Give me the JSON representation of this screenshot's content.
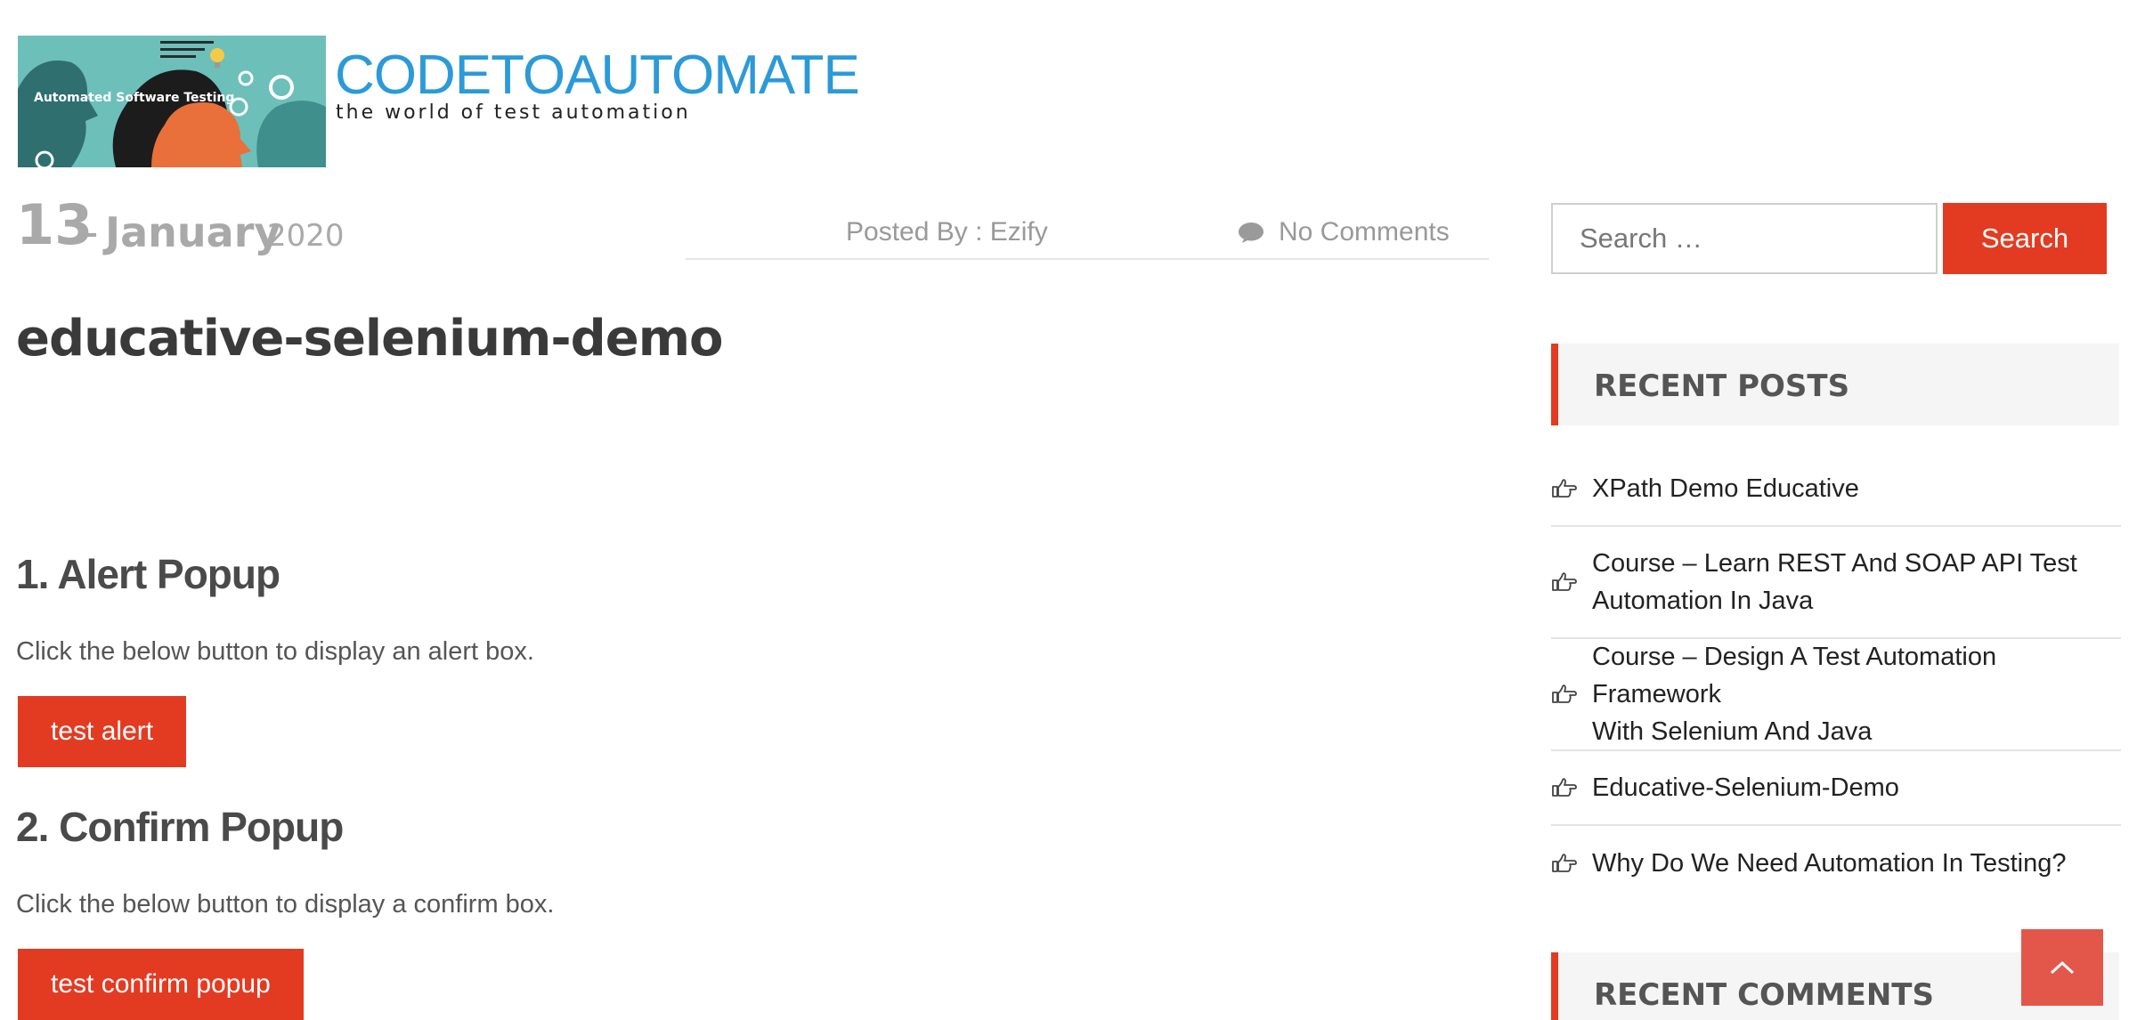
{
  "header": {
    "logo_caption": "Automated Software Testing",
    "site_title": "CODETOAUTOMATE",
    "tagline": "the world of test automation"
  },
  "post": {
    "date_day": "13",
    "date_separator": "–",
    "date_month": "January",
    "date_year": "2020",
    "posted_by": "Posted By : Ezify",
    "comments": "No Comments",
    "title": "educative-selenium-demo"
  },
  "sections": [
    {
      "heading": "1. Alert Popup",
      "text": "Click the below button to display an alert box.",
      "button": "test alert"
    },
    {
      "heading": "2. Confirm Popup",
      "text": "Click the below button to display a confirm box.",
      "button": "test confirm popup"
    }
  ],
  "sidebar": {
    "search_placeholder": "Search …",
    "search_button": "Search",
    "recent_posts_title": "RECENT POSTS",
    "recent_posts": [
      {
        "lines": [
          "XPath Demo Educative"
        ]
      },
      {
        "lines": [
          "Course – Learn REST And SOAP API Test",
          "Automation In Java"
        ]
      },
      {
        "lines": [
          "Course – Design A Test Automation Framework",
          "With Selenium And Java"
        ]
      },
      {
        "lines": [
          "Educative-Selenium-Demo"
        ]
      },
      {
        "lines": [
          "Why Do We Need Automation In Testing?"
        ]
      }
    ],
    "recent_comments_title": "RECENT COMMENTS"
  },
  "colors": {
    "accent": "#e33b22",
    "title_blue": "#2b9ad8",
    "scroll_top": "#e3574a"
  },
  "icons": [
    "comment-icon",
    "hand-pointing-icon",
    "chevron-up-icon"
  ]
}
